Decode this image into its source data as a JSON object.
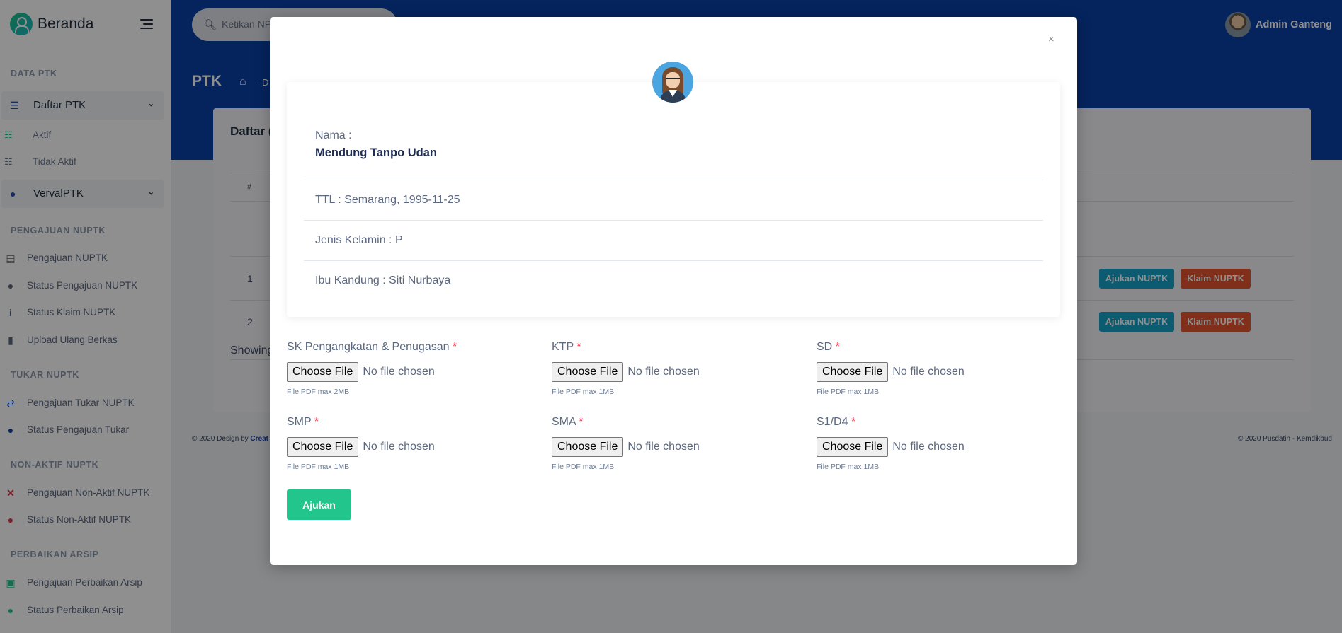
{
  "sidebar": {
    "brand": "Beranda",
    "sections": {
      "data_ptk": "DATA PTK",
      "pengajuan": "PENGAJUAN NUPTK",
      "tukar": "TUKAR NUPTK",
      "nonaktif": "NON-AKTIF NUPTK",
      "arsip": "PERBAIKAN ARSIP"
    },
    "daftar_ptk": "Daftar PTK",
    "aktif": "Aktif",
    "tidak_aktif": "Tidak Aktif",
    "verval": "VervalPTK",
    "items": {
      "pengajuan_nuptk": "Pengajuan NUPTK",
      "status_pengajuan": "Status Pengajuan NUPTK",
      "status_klaim": "Status Klaim NUPTK",
      "upload_ulang": "Upload Ulang Berkas",
      "pengajuan_tukar": "Pengajuan Tukar NUPTK",
      "status_tukar": "Status Pengajuan Tukar",
      "pengajuan_nonaktif": "Pengajuan Non-Aktif NUPTK",
      "status_nonaktif": "Status Non-Aktif NUPTK",
      "pengajuan_arsip": "Pengajuan Perbaikan Arsip",
      "status_arsip": "Status Perbaikan Arsip"
    }
  },
  "header": {
    "search_placeholder": "Ketikan NP",
    "user_name": "Admin Ganteng",
    "page_title": "PTK",
    "breadcrumb_sep": "- D"
  },
  "card": {
    "title": "Daftar (",
    "col_hash": "#",
    "rows": [
      "1",
      "2"
    ],
    "btn_ajukan": "Ajukan NUPTK",
    "btn_klaim": "Klaim NUPTK",
    "showing": "Showing"
  },
  "footer": {
    "left": "© 2020 Design by",
    "left_link": "Creat",
    "right": "© 2020 Pusdatin - Kemdikbud"
  },
  "modal": {
    "close": "×",
    "nama_label": "Nama :",
    "nama_value": "Mendung Tanpo Udan",
    "ttl": "TTL : Semarang, 1995-11-25",
    "jk": "Jenis Kelamin : P",
    "ibu": "Ibu Kandung : Siti Nurbaya",
    "choose_file": "Choose File",
    "no_file": "No file chosen",
    "required_mark": "*",
    "files": {
      "sk": {
        "label": "SK Pengangkatan & Penugasan",
        "hint": "File PDF max 2MB"
      },
      "ktp": {
        "label": "KTP",
        "hint": "File PDF max 1MB"
      },
      "sd": {
        "label": "SD",
        "hint": "File PDF max 1MB"
      },
      "smp": {
        "label": "SMP",
        "hint": "File PDF max 1MB"
      },
      "sma": {
        "label": "SMA",
        "hint": "File PDF max 1MB"
      },
      "s1": {
        "label": "S1/D4",
        "hint": "File PDF max 1MB"
      }
    },
    "submit": "Ajukan"
  },
  "colors": {
    "topbar": "#0a3fa6",
    "ajukan_btn": "#17a2c9",
    "klaim_btn": "#e2552f",
    "submit_btn": "#22c58b",
    "required": "#e0354b"
  }
}
